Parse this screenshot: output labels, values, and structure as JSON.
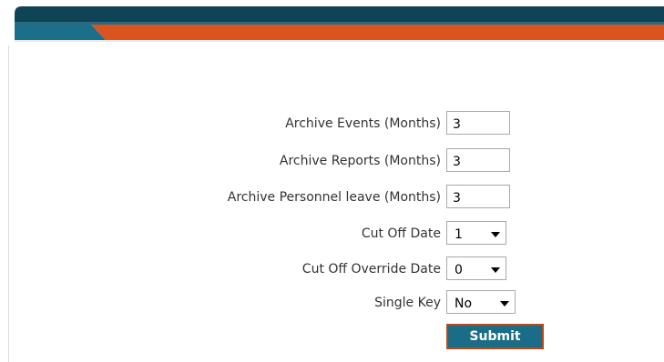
{
  "form": {
    "fields": [
      {
        "label": "Archive Events (Months)",
        "value": "3",
        "kind": "text"
      },
      {
        "label": "Archive Reports (Months)",
        "value": "3",
        "kind": "text"
      },
      {
        "label": "Archive Personnel leave (Months)",
        "value": "3",
        "kind": "text"
      },
      {
        "label": "Cut Off Date",
        "value": "1",
        "kind": "select"
      },
      {
        "label": "Cut Off Override Date",
        "value": "0",
        "kind": "select"
      },
      {
        "label": "Single Key",
        "value": "No",
        "kind": "select"
      }
    ],
    "submit_label": "Submit"
  },
  "colors": {
    "header_dark": "#0e4456",
    "header_teal": "#1a6f8a",
    "header_orange": "#d9541e",
    "button_bg": "#1b6c86",
    "button_border": "#b54a1a"
  }
}
